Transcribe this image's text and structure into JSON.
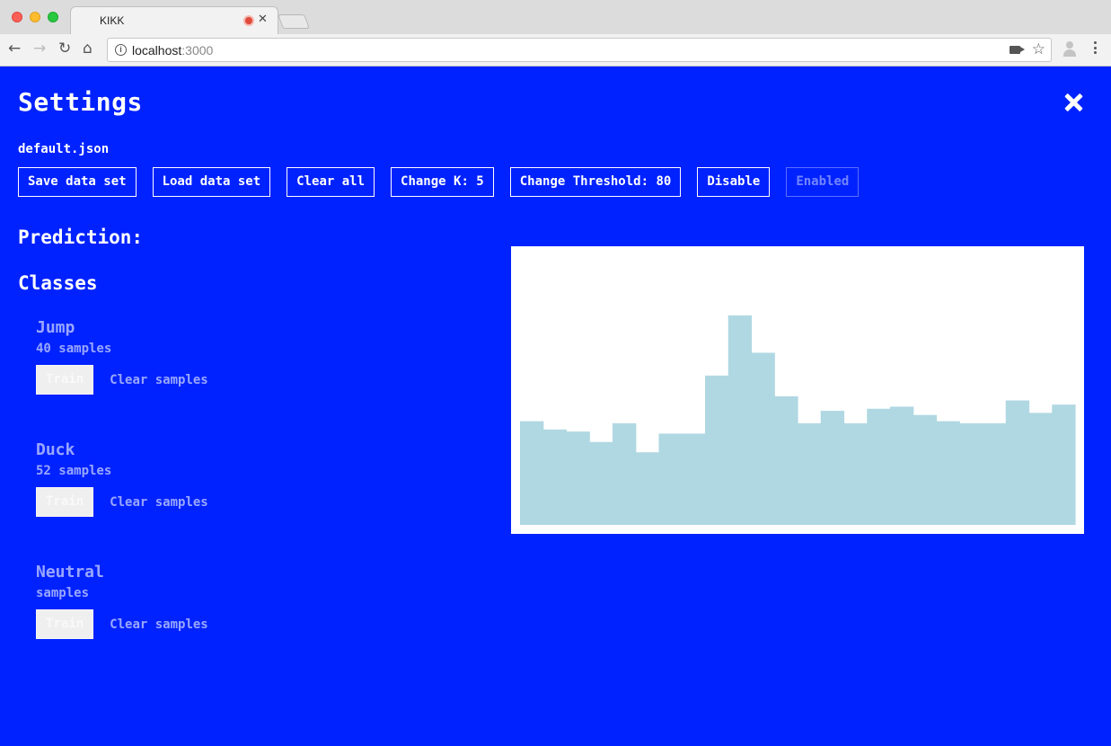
{
  "browser": {
    "tab_title": "KIKK",
    "url_host": "localhost",
    "url_port": ":3000"
  },
  "settings": {
    "title": "Settings",
    "filename": "default.json",
    "buttons": {
      "save": "Save data set",
      "load": "Load data set",
      "clear_all": "Clear all",
      "change_k": "Change K: 5",
      "change_threshold": "Change Threshold: 80",
      "disable": "Disable",
      "enabled": "Enabled"
    },
    "prediction_label": "Prediction:",
    "classes_heading": "Classes",
    "classes": [
      {
        "name": "Jump",
        "count": "40 samples",
        "train": "Train",
        "clear": "Clear samples"
      },
      {
        "name": "Duck",
        "count": "52 samples",
        "train": "Train",
        "clear": "Clear samples"
      },
      {
        "name": "Neutral",
        "count": "samples",
        "train": "Train",
        "clear": "Clear samples"
      }
    ]
  },
  "colors": {
    "background": "#0022ff",
    "chart_fill": "#b0d8e2",
    "chart_bg": "#ffffff"
  },
  "chart_data": {
    "type": "area",
    "step": true,
    "x": [
      1,
      2,
      3,
      4,
      5,
      6,
      7,
      8,
      9,
      10,
      11,
      12,
      13,
      14,
      15,
      16,
      17,
      18,
      19,
      20,
      21,
      22,
      23,
      24
    ],
    "values": [
      50,
      46,
      45,
      40,
      49,
      35,
      44,
      44,
      72,
      101,
      83,
      62,
      49,
      55,
      49,
      56,
      57,
      53,
      50,
      49,
      49,
      60,
      54,
      58
    ],
    "ylim": [
      0,
      130
    ],
    "grid": false,
    "legend": "none"
  }
}
